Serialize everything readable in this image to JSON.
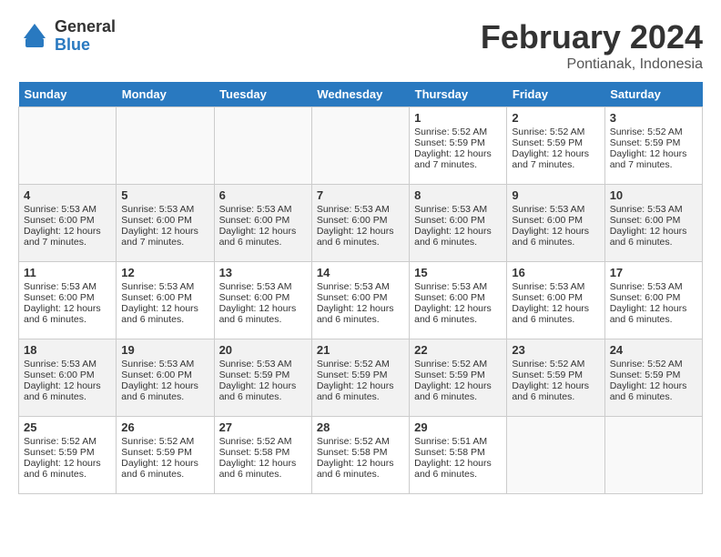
{
  "header": {
    "logo_line1": "General",
    "logo_line2": "Blue",
    "month_title": "February 2024",
    "location": "Pontianak, Indonesia"
  },
  "days_of_week": [
    "Sunday",
    "Monday",
    "Tuesday",
    "Wednesday",
    "Thursday",
    "Friday",
    "Saturday"
  ],
  "weeks": [
    [
      {
        "day": "",
        "content": ""
      },
      {
        "day": "",
        "content": ""
      },
      {
        "day": "",
        "content": ""
      },
      {
        "day": "",
        "content": ""
      },
      {
        "day": "1",
        "content": "Sunrise: 5:52 AM\nSunset: 5:59 PM\nDaylight: 12 hours\nand 7 minutes."
      },
      {
        "day": "2",
        "content": "Sunrise: 5:52 AM\nSunset: 5:59 PM\nDaylight: 12 hours\nand 7 minutes."
      },
      {
        "day": "3",
        "content": "Sunrise: 5:52 AM\nSunset: 5:59 PM\nDaylight: 12 hours\nand 7 minutes."
      }
    ],
    [
      {
        "day": "4",
        "content": "Sunrise: 5:53 AM\nSunset: 6:00 PM\nDaylight: 12 hours\nand 7 minutes."
      },
      {
        "day": "5",
        "content": "Sunrise: 5:53 AM\nSunset: 6:00 PM\nDaylight: 12 hours\nand 7 minutes."
      },
      {
        "day": "6",
        "content": "Sunrise: 5:53 AM\nSunset: 6:00 PM\nDaylight: 12 hours\nand 6 minutes."
      },
      {
        "day": "7",
        "content": "Sunrise: 5:53 AM\nSunset: 6:00 PM\nDaylight: 12 hours\nand 6 minutes."
      },
      {
        "day": "8",
        "content": "Sunrise: 5:53 AM\nSunset: 6:00 PM\nDaylight: 12 hours\nand 6 minutes."
      },
      {
        "day": "9",
        "content": "Sunrise: 5:53 AM\nSunset: 6:00 PM\nDaylight: 12 hours\nand 6 minutes."
      },
      {
        "day": "10",
        "content": "Sunrise: 5:53 AM\nSunset: 6:00 PM\nDaylight: 12 hours\nand 6 minutes."
      }
    ],
    [
      {
        "day": "11",
        "content": "Sunrise: 5:53 AM\nSunset: 6:00 PM\nDaylight: 12 hours\nand 6 minutes."
      },
      {
        "day": "12",
        "content": "Sunrise: 5:53 AM\nSunset: 6:00 PM\nDaylight: 12 hours\nand 6 minutes."
      },
      {
        "day": "13",
        "content": "Sunrise: 5:53 AM\nSunset: 6:00 PM\nDaylight: 12 hours\nand 6 minutes."
      },
      {
        "day": "14",
        "content": "Sunrise: 5:53 AM\nSunset: 6:00 PM\nDaylight: 12 hours\nand 6 minutes."
      },
      {
        "day": "15",
        "content": "Sunrise: 5:53 AM\nSunset: 6:00 PM\nDaylight: 12 hours\nand 6 minutes."
      },
      {
        "day": "16",
        "content": "Sunrise: 5:53 AM\nSunset: 6:00 PM\nDaylight: 12 hours\nand 6 minutes."
      },
      {
        "day": "17",
        "content": "Sunrise: 5:53 AM\nSunset: 6:00 PM\nDaylight: 12 hours\nand 6 minutes."
      }
    ],
    [
      {
        "day": "18",
        "content": "Sunrise: 5:53 AM\nSunset: 6:00 PM\nDaylight: 12 hours\nand 6 minutes."
      },
      {
        "day": "19",
        "content": "Sunrise: 5:53 AM\nSunset: 6:00 PM\nDaylight: 12 hours\nand 6 minutes."
      },
      {
        "day": "20",
        "content": "Sunrise: 5:53 AM\nSunset: 5:59 PM\nDaylight: 12 hours\nand 6 minutes."
      },
      {
        "day": "21",
        "content": "Sunrise: 5:52 AM\nSunset: 5:59 PM\nDaylight: 12 hours\nand 6 minutes."
      },
      {
        "day": "22",
        "content": "Sunrise: 5:52 AM\nSunset: 5:59 PM\nDaylight: 12 hours\nand 6 minutes."
      },
      {
        "day": "23",
        "content": "Sunrise: 5:52 AM\nSunset: 5:59 PM\nDaylight: 12 hours\nand 6 minutes."
      },
      {
        "day": "24",
        "content": "Sunrise: 5:52 AM\nSunset: 5:59 PM\nDaylight: 12 hours\nand 6 minutes."
      }
    ],
    [
      {
        "day": "25",
        "content": "Sunrise: 5:52 AM\nSunset: 5:59 PM\nDaylight: 12 hours\nand 6 minutes."
      },
      {
        "day": "26",
        "content": "Sunrise: 5:52 AM\nSunset: 5:59 PM\nDaylight: 12 hours\nand 6 minutes."
      },
      {
        "day": "27",
        "content": "Sunrise: 5:52 AM\nSunset: 5:58 PM\nDaylight: 12 hours\nand 6 minutes."
      },
      {
        "day": "28",
        "content": "Sunrise: 5:52 AM\nSunset: 5:58 PM\nDaylight: 12 hours\nand 6 minutes."
      },
      {
        "day": "29",
        "content": "Sunrise: 5:51 AM\nSunset: 5:58 PM\nDaylight: 12 hours\nand 6 minutes."
      },
      {
        "day": "",
        "content": ""
      },
      {
        "day": "",
        "content": ""
      }
    ]
  ]
}
